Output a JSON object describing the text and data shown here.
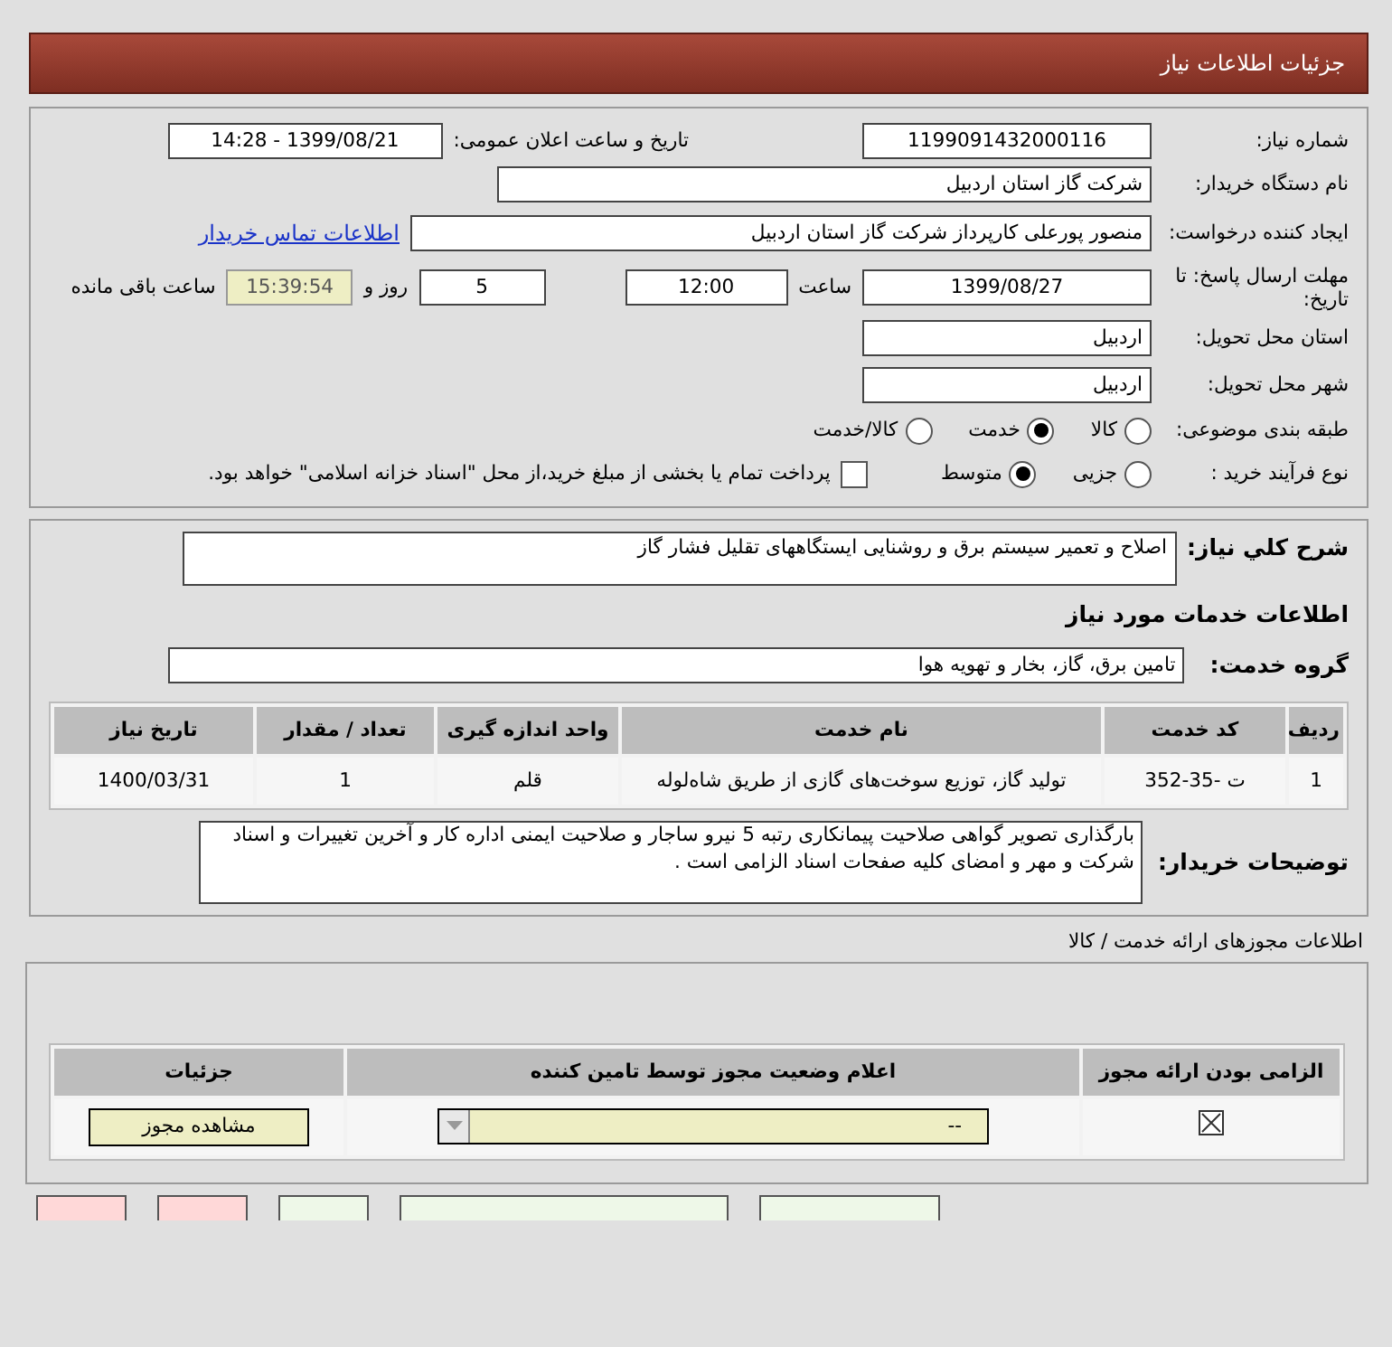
{
  "header": {
    "title": "جزئیات اطلاعات نیاز"
  },
  "need_number": {
    "label": "شماره نیاز:",
    "value": "1199091432000116"
  },
  "announce": {
    "label": "تاریخ و ساعت اعلان عمومی:",
    "value": "1399/08/21 - 14:28"
  },
  "buyer": {
    "label": "نام دستگاه خریدار:",
    "value": "شرکت گاز استان اردبیل"
  },
  "creator": {
    "label": "ایجاد کننده درخواست:",
    "value": "منصور  پورعلی کارپرداز شرکت گاز استان اردبیل",
    "link": "اطلاعات تماس خریدار"
  },
  "deadline": {
    "label": "مهلت ارسال پاسخ: تا تاریخ:",
    "date": "1399/08/27",
    "time_label": "ساعت",
    "time": "12:00",
    "days": "5",
    "days_label": "روز و",
    "remaining": "15:39:54",
    "remaining_label": "ساعت باقی مانده"
  },
  "province": {
    "label": "استان محل تحویل:",
    "value": "اردبیل"
  },
  "city": {
    "label": "شهر محل تحویل:",
    "value": "اردبیل"
  },
  "category": {
    "label": "طبقه بندی موضوعی:",
    "options": [
      {
        "label": "کالا",
        "selected": false
      },
      {
        "label": "خدمت",
        "selected": true
      },
      {
        "label": "کالا/خدمت",
        "selected": false
      }
    ]
  },
  "purchase_type": {
    "label": "نوع فرآیند خرید :",
    "options": [
      {
        "label": "جزیی",
        "selected": false
      },
      {
        "label": "متوسط",
        "selected": true
      }
    ],
    "treasury": {
      "label": "پرداخت تمام یا بخشی از مبلغ خرید،از محل \"اسناد خزانه اسلامی\" خواهد بود.",
      "checked": false
    }
  },
  "description": {
    "label": "شرح کلي نياز:",
    "value": "اصلاح و تعمیر سیستم برق و روشنایی ایستگاههای تقلیل فشار گاز"
  },
  "services_heading": "اطلاعات خدمات مورد نياز",
  "service_group": {
    "label": "گروه خدمت:",
    "value": "تامین برق، گاز، بخار و تهویه هوا"
  },
  "table": {
    "columns": [
      "ردیف",
      "کد خدمت",
      "نام خدمت",
      "واحد اندازه گیری",
      "تعداد / مقدار",
      "تاریخ نیاز"
    ],
    "rows": [
      [
        "1",
        "ت -35-352",
        "تولید گاز، توزیع سوخت‌های گازی از طریق شاه‌لوله",
        "قلم",
        "1",
        "1400/03/31"
      ]
    ]
  },
  "buyer_notes": {
    "label": "توضیحات خریدار:",
    "value": "بارگذاری تصویر گواهی صلاحیت پیمانکاری رتبه 5 نیرو ساجار و صلاحیت ایمنی اداره کار و آخرین تغییرات و اسناد شرکت و مهر و امضای کلیه صفحات اسناد الزامی است ."
  },
  "licenses": {
    "title": "اطلاعات مجوزهای ارائه خدمت / کالا",
    "columns": [
      "الزامی بودن ارائه مجوز",
      "اعلام وضعیت مجوز توسط تامین کننده",
      "جزئیات"
    ],
    "rows": [
      {
        "required": true,
        "status": "--",
        "button": "مشاهده مجوز"
      }
    ]
  },
  "bottom_buttons": [
    {
      "color": "#eef8e8"
    },
    {
      "color": "#eef8e8"
    },
    {
      "color": "#eef8e8"
    },
    {
      "color": "#ffd8d8"
    },
    {
      "color": "#ffd8d8"
    }
  ]
}
